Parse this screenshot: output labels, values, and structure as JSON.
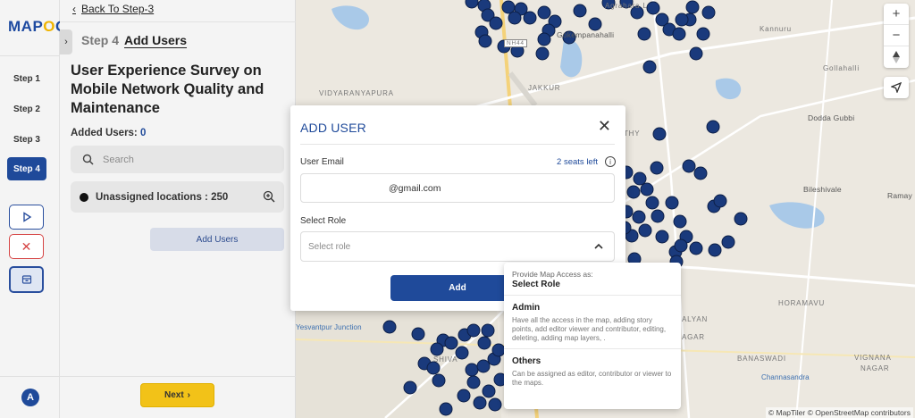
{
  "app": {
    "logo_text_a": "MAP",
    "logo_text_o": "O",
    "logo_text_g": "G"
  },
  "rail": {
    "steps": [
      "Step 1",
      "Step 2",
      "Step 3",
      "Step 4"
    ],
    "active_step": "Step 4",
    "avatar_letter": "A"
  },
  "panel": {
    "back_label": "Back To Step-3",
    "step_number": "Step 4",
    "step_name": "Add Users",
    "survey_title": "User Experience Survey on Mobile Network Quality and Maintenance",
    "added_users_label": "Added Users:",
    "added_users_count": "0",
    "search_placeholder": "Search",
    "unassigned_label": "Unassigned locations : 250",
    "add_users_button": "Add Users",
    "next_button": "Next"
  },
  "map": {
    "labels": {
      "agrahara": "Agrahara L",
      "kannuru": "Kannuru",
      "nh44": "NH44",
      "gollahalli": "Gollahalli",
      "kempanahalli": "Gokempanahalli",
      "vidyaranyapura": "VIDYARANYAPURA",
      "jakkur": "JAKKUR",
      "dodda_gubbi": "Dodda Gubbi",
      "athy": "THY",
      "bileshivale": "Bileshivale",
      "ramayy": "Ramay",
      "yesvantpur": "Yesvantpur Junction",
      "horamavu": "HORAMAVU",
      "kalyan": "ALYAN",
      "agar": "AGAR",
      "banaswadi": "BANASWADI",
      "vignana": "VIGNANA",
      "nagar": "NAGAR",
      "channasandra": "Channasandra",
      "shiva": "SHIVA"
    },
    "controls": [
      "+",
      "−"
    ],
    "attribution": "© MapTiler © OpenStreetMap contributors"
  },
  "modal": {
    "title": "ADD USER",
    "email_label": "User Email",
    "seats_left": "2 seats left",
    "email_value": "@gmail.com",
    "role_label": "Select Role",
    "role_placeholder": "Select role",
    "add_button": "Add"
  },
  "dropdown": {
    "header_small": "Provide Map Access as:",
    "header_big": "Select Role",
    "options": [
      {
        "title": "Admin",
        "desc": "Have all the access in the map, adding story points, add editor viewer and contributor, editing, deleting, adding map layers, ."
      },
      {
        "title": "Others",
        "desc": "Can be assigned as editor, contributor or viewer to the maps."
      }
    ]
  },
  "colors": {
    "accent": "#1f4a9a",
    "marker": "#1a3a7c",
    "next_button": "#f2c218",
    "water": "#a9c9e8"
  }
}
